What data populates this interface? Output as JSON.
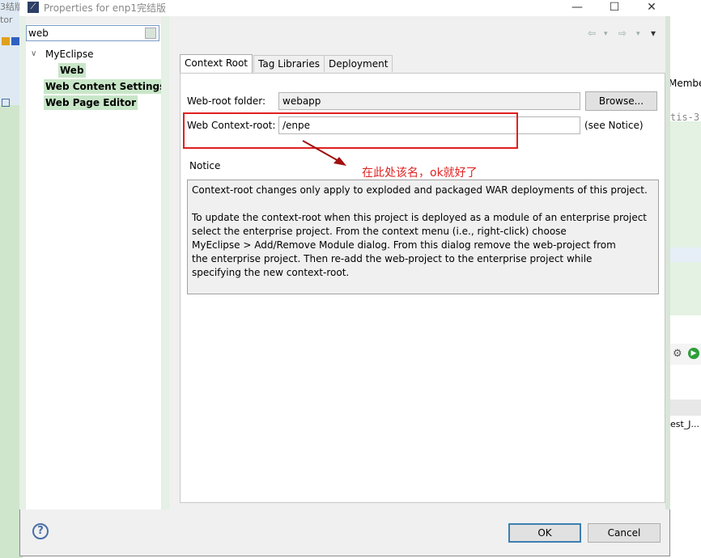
{
  "background": {
    "left_fragments": [
      "3结版",
      "tor"
    ],
    "right_fragments": [
      "Membe",
      "tis-3",
      "est_J..."
    ]
  },
  "window": {
    "title": "Properties for enp1完结版",
    "minimize": "—",
    "maximize": "☐",
    "close": "✕"
  },
  "nav": {
    "filter_value": "web",
    "tree": {
      "root_label": "MyEclipse",
      "child_label": "Web",
      "items": [
        "Web Content Settings",
        "Web Page Editor"
      ]
    },
    "history": {
      "back": "⇦",
      "forward": "⇨",
      "menu": "▾"
    }
  },
  "tabs": [
    "Context Root",
    "Tag Libraries",
    "Deployment"
  ],
  "form": {
    "web_root_label": "Web-root folder:",
    "web_root_value": "webapp",
    "browse_label": "Browse...",
    "context_root_label": "Web Context-root:",
    "context_root_value": "/enpe",
    "see_notice": "(see Notice)"
  },
  "notice": {
    "heading": "Notice",
    "text": "Context-root changes only apply to exploded and packaged WAR deployments of this project.\n\nTo update the context-root when this project is deployed as a module of an enterprise project\nselect the enterprise project. From the context menu (i.e., right-click) choose\nMyEclipse > Add/Remove Module dialog. From this dialog remove the web-project from\nthe enterprise project. Then re-add the web-project to the enterprise project while\nspecifying the new context-root."
  },
  "annotation": "在此处该名，ok就好了",
  "footer": {
    "help": "?",
    "ok_label": "OK",
    "cancel_label": "Cancel"
  },
  "colors": {
    "annotation_red": "#e02020",
    "tree_highlight": "#c8e6c8",
    "default_button_border": "#3c7fb1"
  }
}
